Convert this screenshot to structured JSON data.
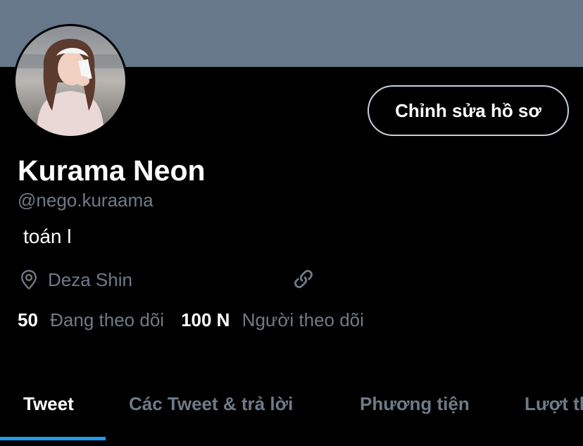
{
  "profile": {
    "edit_button_label": "Chỉnh sửa hồ sơ",
    "display_name": "Kurama Neon",
    "handle": "@nego.kuraama",
    "bio": "toán l",
    "location": "Deza Shin"
  },
  "stats": {
    "following_count": "50",
    "following_label": "Đang theo dõi",
    "followers_count": "100 N",
    "followers_label": "Người theo dõi"
  },
  "tabs": [
    {
      "label": "Tweet",
      "active": true
    },
    {
      "label": "Các Tweet & trả lời",
      "active": false
    },
    {
      "label": "Phương tiện",
      "active": false
    },
    {
      "label": "Lượt thích",
      "active": false
    }
  ],
  "colors": {
    "banner": "#66788a",
    "background": "#000000",
    "muted_text": "#6e7b87",
    "accent": "#1d9bf0"
  },
  "icons": {
    "location": "location-pin-icon",
    "link": "link-icon"
  }
}
